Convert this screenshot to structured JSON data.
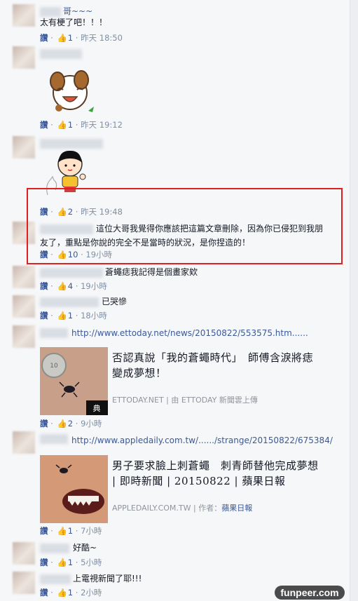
{
  "ui": {
    "like_label": "讚"
  },
  "comments": [
    {
      "name_suffix": "哥~~~",
      "text": "太有梗了吧！！！",
      "likes": "1",
      "time": "昨天 18:50"
    },
    {
      "likes": "1",
      "time": "昨天 19:12"
    },
    {
      "likes": "2",
      "time": "昨天 19:48"
    },
    {
      "text": "這位大哥我覺得你應該把這篇文章刪除，因為你已侵犯到我朋友了，重點是你說的完全不是當時的狀況，是你捏造的！",
      "likes": "10",
      "time": "19小時"
    },
    {
      "text": "蒼蠅痣我記得是個畫家欸",
      "likes": "4",
      "time": "19小時"
    },
    {
      "text": "已哭慘",
      "likes": "1",
      "time": "18小時"
    },
    {
      "link": "http://www.ettoday.net/news/20150822/553575.htm......",
      "preview_title": "否認真說「我的蒼蠅時代」　師傅含淚將痣變成夢想！",
      "preview_source": "ETTODAY.NET | 由 ETTODAY 新聞雲上傳",
      "likes": "2",
      "time": "9小時"
    },
    {
      "link": "http://www.appledaily.com.tw/....../strange/20150822/675384/",
      "preview_title": "男子要求臉上刺蒼蠅　刺青師替他完成夢想 | 即時新聞 | 20150822 | 蘋果日報",
      "preview_source": "APPLEDAILY.COM.TW",
      "preview_author_label": "作者：",
      "preview_author": "蘋果日報",
      "likes": "1",
      "time": "7小時"
    },
    {
      "text": "好酷~",
      "likes": "1",
      "time": "5小時"
    },
    {
      "text": "上電視新聞了耶!!!",
      "likes": "1",
      "time": "2小時"
    }
  ],
  "watermark": "funpeer.com"
}
